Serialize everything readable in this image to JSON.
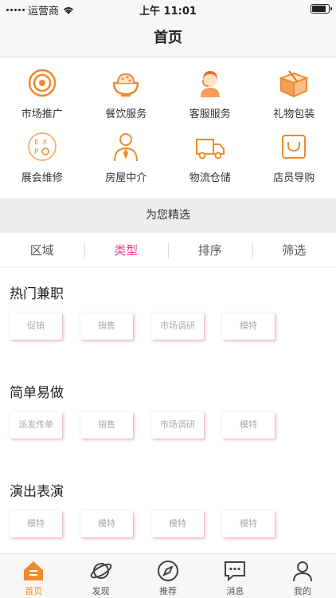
{
  "status_bar": {
    "carrier": "运营商",
    "time": "上午 11:01",
    "battery_level": 0.85
  },
  "nav": {
    "title": "首页"
  },
  "services": [
    {
      "label": "市场推广",
      "icon": "target-icon"
    },
    {
      "label": "餐饮服务",
      "icon": "bowl-icon"
    },
    {
      "label": "客服服务",
      "icon": "customer-service-icon"
    },
    {
      "label": "礼物包装",
      "icon": "gift-box-icon"
    },
    {
      "label": "展会维修",
      "icon": "expo-icon"
    },
    {
      "label": "房屋中介",
      "icon": "agent-icon"
    },
    {
      "label": "物流仓储",
      "icon": "truck-icon"
    },
    {
      "label": "店员导购",
      "icon": "shopping-bag-icon"
    }
  ],
  "featured": {
    "title": "为您精选"
  },
  "filters": [
    {
      "label": "区域",
      "active": false
    },
    {
      "label": "类型",
      "active": true
    },
    {
      "label": "排序",
      "active": false
    },
    {
      "label": "筛选",
      "active": false
    }
  ],
  "sections": [
    {
      "title": "热门兼职",
      "tags": [
        "促销",
        "销售",
        "市场调研",
        "模特"
      ]
    },
    {
      "title": "简单易做",
      "tags": [
        "派发传单",
        "销售",
        "市场调研",
        "模特"
      ]
    },
    {
      "title": "演出表演",
      "tags": [
        "模特",
        "模特",
        "模特",
        "模特"
      ]
    }
  ],
  "tab_bar": [
    {
      "label": "首页",
      "icon": "home-icon",
      "active": true
    },
    {
      "label": "发现",
      "icon": "planet-icon",
      "active": false
    },
    {
      "label": "推荐",
      "icon": "compass-icon",
      "active": false
    },
    {
      "label": "消息",
      "icon": "message-icon",
      "active": false
    },
    {
      "label": "我的",
      "icon": "user-icon",
      "active": false
    }
  ],
  "colors": {
    "accent": "#f08a2e",
    "active_filter": "#e8468a",
    "tag_shadow": "#e8468a"
  }
}
